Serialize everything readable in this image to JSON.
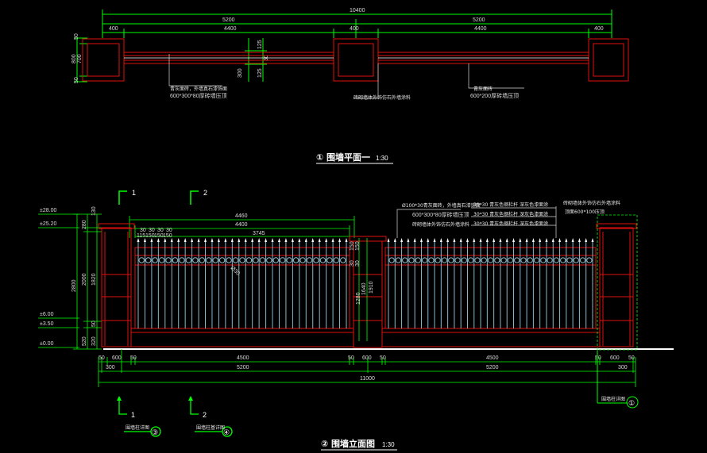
{
  "colors": {
    "background": "#000000",
    "dimension": "#00ff00",
    "wall": "#e01010",
    "fence": "#8fb7c8",
    "text": "#e8e8e8",
    "highlight": "#ffffff",
    "leader": "#d8d8d8"
  },
  "plan": {
    "dims": {
      "total": "10400",
      "half_left": "5200",
      "half_right": "5200",
      "pier_left": "400",
      "span_left": "4400",
      "pier_mid": "400",
      "span_right": "4400",
      "pier_right": "400",
      "depth_total": "800",
      "depth_inner": "700",
      "depth_top": "50",
      "depth_bottom": "50",
      "mid_125_top": "125",
      "mid_50": "50",
      "mid_125_bottom": "125",
      "mid_300": "300"
    },
    "notes": {
      "n1": "青灰面砖，外墙真石漆饰面",
      "n1_spec": "600*300*80厚砖墙压顶",
      "n2": "砖砌墙体外饰仿石外墙涂料",
      "n3": "青灰面砖",
      "n3_spec": "600*200厚砖墙压顶"
    },
    "title_num": "①",
    "title_text": "围墙平面一",
    "title_scale": "1:30"
  },
  "elevation": {
    "levels": [
      "±28.00",
      "±25.20",
      "±6.00",
      "±3.50",
      "±0.00"
    ],
    "left_dims": {
      "h_total": "2800",
      "h_2000": "2000",
      "h_1820": "1820",
      "h_280": "280",
      "h_130": "130",
      "h_520": "520",
      "h_320": "320",
      "h_50": "50"
    },
    "top_dims": {
      "d4460": "4460",
      "d4400": "4400",
      "d3745": "3745",
      "d30a": "30",
      "d30b": "30",
      "d30c": "30",
      "d30d": "30",
      "d115": "115",
      "d150a": "150",
      "d150b": "150",
      "d150c": "150"
    },
    "inner_dims": {
      "d1640": "1640",
      "d1910": "1910",
      "d1280": "1280",
      "d30a": "30",
      "d30b": "30",
      "d150a": "150",
      "d150b": "150",
      "rail_note": "Ø30"
    },
    "bottom_dims": {
      "b50a": "50",
      "b600a": "600",
      "b50b": "50",
      "b4500a": "4500",
      "b50c": "50",
      "b600b": "600",
      "b50d": "50",
      "b4500b": "4500",
      "b50e": "50",
      "b600c": "600",
      "b50f": "50",
      "b300a": "300",
      "b5200a": "5200",
      "b5200b": "5200",
      "b300b": "300",
      "b11000": "11000"
    },
    "notes": {
      "a1": "Ø100*30青灰面砖，外墙真石漆饰面",
      "a2": "600*300*80厚砖墙压顶",
      "a3": "砖砌墙体外饰仿石外墙涂料",
      "b1": "30*30 青灰色钢栏杆 深灰色漆面涂",
      "b2": "30*30 青灰色钢栏杆 深灰色漆面涂",
      "b3": "30*30 青灰色钢栏杆 深灰色漆面涂",
      "c1": "砖砌墙体外饰仿石外墙涂料",
      "c2": "顶面600*100压顶"
    },
    "section_marks": [
      "1",
      "2"
    ],
    "bottom_marks": [
      {
        "num": "1",
        "label": "围墙柱详图",
        "ref": "③"
      },
      {
        "num": "2",
        "label": "围墙柱基详图",
        "ref": "④"
      }
    ],
    "right_mark": {
      "label": "围墙柱详图",
      "ref": "①"
    },
    "title_num": "②",
    "title_text": "围墙立面图",
    "title_scale": "1:30"
  }
}
